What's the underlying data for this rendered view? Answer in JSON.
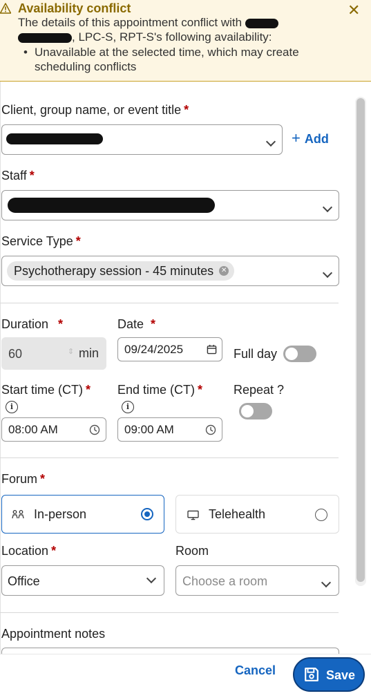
{
  "alert": {
    "title": "Availability conflict",
    "body_prefix": "The details of this appointment conflict with",
    "body_suffix": ", LPC-S, RPT-S's following availability:",
    "bullet": "Unavailable at the selected time, which may create scheduling conflicts",
    "close_icon": "close-icon",
    "warning_icon": "warning-icon",
    "color": "#8a6a00"
  },
  "form": {
    "client": {
      "label": "Client, group name, or event title",
      "add_label": "Add"
    },
    "staff": {
      "label": "Staff"
    },
    "service": {
      "label": "Service Type",
      "chip": "Psychotherapy session - 45 minutes"
    },
    "duration": {
      "label": "Duration",
      "value": "60",
      "unit": "min"
    },
    "date": {
      "label": "Date",
      "value": "09/24/2025"
    },
    "full_day": {
      "label": "Full day",
      "on": false
    },
    "start_time": {
      "label": "Start time (CT)",
      "value": "08:00 AM"
    },
    "end_time": {
      "label": "End time (CT)",
      "value": "09:00 AM"
    },
    "repeat": {
      "label": "Repeat ?",
      "on": false
    },
    "forum": {
      "label": "Forum",
      "options": [
        "In-person",
        "Telehealth"
      ],
      "selected": "In-person"
    },
    "location": {
      "label": "Location",
      "value": "Office"
    },
    "room": {
      "label": "Room",
      "placeholder": "Choose a room"
    },
    "notes": {
      "label": "Appointment notes"
    }
  },
  "footer": {
    "cancel_label": "Cancel",
    "save_label": "Save"
  },
  "colors": {
    "accent": "#1565c0",
    "required": "#b30000",
    "alert_bg": "#fdf6e3"
  }
}
